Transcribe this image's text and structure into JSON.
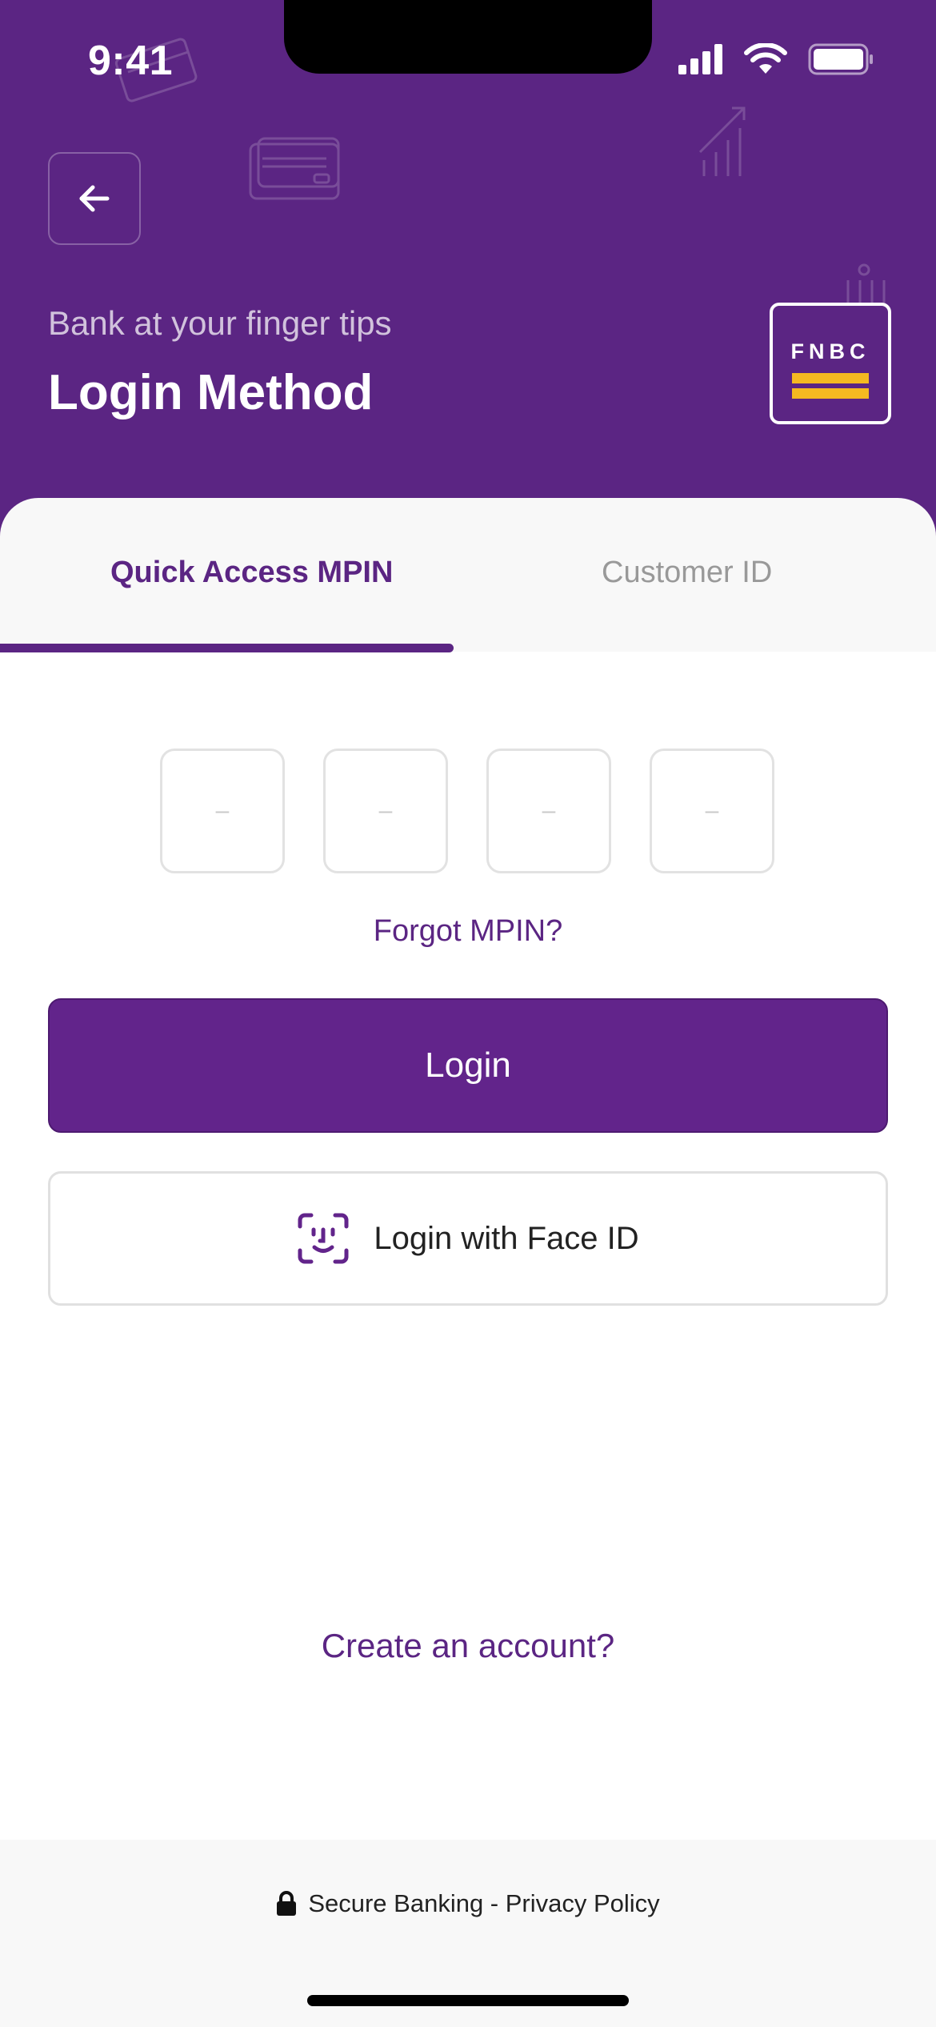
{
  "status_bar": {
    "time": "9:41"
  },
  "header": {
    "tagline": "Bank at your finger tips",
    "title": "Login Method",
    "logo_text": "FNBC",
    "accent_color": "#5b2583",
    "logo_bar_color": "#f5b921"
  },
  "tabs": [
    {
      "label": "Quick Access MPIN",
      "active": true
    },
    {
      "label": "Customer ID",
      "active": false
    }
  ],
  "pin": {
    "placeholder": "–",
    "digits": 4
  },
  "forgot_label": "Forgot MPIN?",
  "login_label": "Login",
  "face_id_label": "Login with Face ID",
  "create_account_label": "Create an account?",
  "footer": {
    "text": "Secure Banking - Privacy Policy"
  },
  "icons": [
    "back-arrow-icon",
    "signal-icon",
    "wifi-icon",
    "battery-icon",
    "face-id-icon",
    "lock-icon"
  ]
}
